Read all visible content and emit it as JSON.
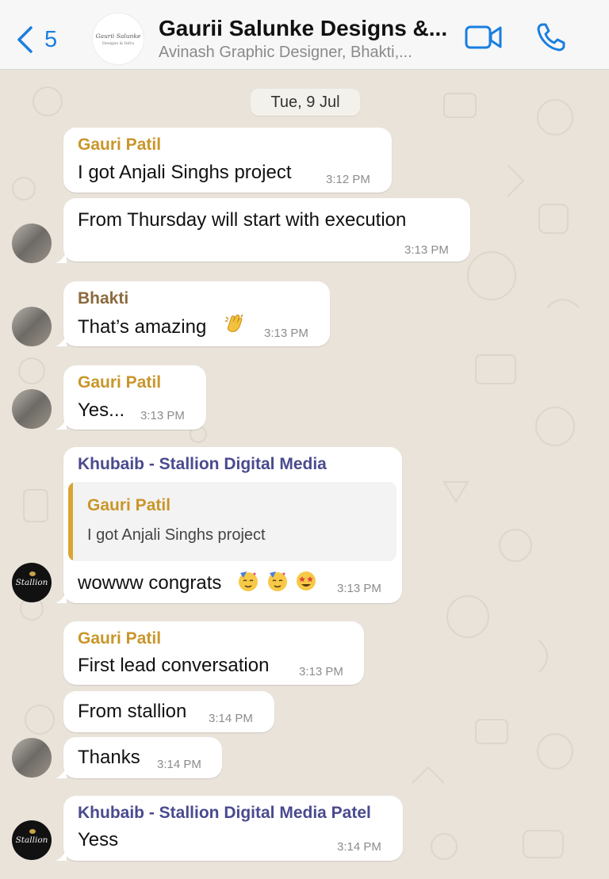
{
  "header": {
    "back_count": "5",
    "group_avatar_line1": "Gaurii Salunke",
    "group_avatar_line2": "Designs & Infra",
    "title": "Gaurii Salunke Designs &...",
    "subtitle": "Avinash Graphic Designer, Bhakti,..."
  },
  "date_label": "Tue, 9 Jul",
  "avatars": {
    "stallion_text": "Stallion"
  },
  "messages": [
    {
      "sender": "Gauri Patil",
      "text": "I got Anjali Singhs project",
      "time": "3:12 PM"
    },
    {
      "text": "From Thursday will start with execution",
      "time": "3:13 PM"
    },
    {
      "sender": "Bhakti",
      "text": "That’s amazing",
      "emoji": "clapping-hands",
      "time": "3:13 PM"
    },
    {
      "sender": "Gauri Patil",
      "text": "Yes...",
      "time": "3:13 PM"
    },
    {
      "sender": "Khubaib - Stallion Digital Media",
      "quote": {
        "sender": "Gauri Patil",
        "text": "I got Anjali Singhs project"
      },
      "text": "wowww congrats",
      "emojis": [
        "partying-face",
        "partying-face",
        "star-struck"
      ],
      "time": "3:13 PM"
    },
    {
      "sender": "Gauri Patil",
      "text": "First lead conversation",
      "time": "3:13 PM"
    },
    {
      "text": "From stallion",
      "time": "3:14 PM"
    },
    {
      "text": "Thanks",
      "time": "3:14 PM"
    },
    {
      "sender": "Khubaib - Stallion Digital Media Patel",
      "text": "Yess",
      "time": "3:14 PM"
    }
  ],
  "colors": {
    "accent": "#1a7ee0",
    "gauri": "#c9962a",
    "bhakti": "#8b6a3e",
    "khubaib": "#4a4a8f",
    "chat_bg": "#e9e3da"
  }
}
